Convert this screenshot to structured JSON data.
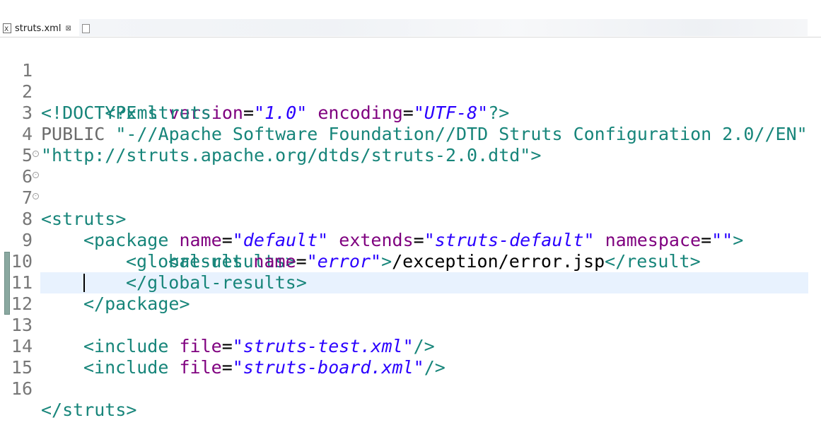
{
  "tab": {
    "label": "struts.xml",
    "close_glyph": "⊠"
  },
  "editor": {
    "lines": [
      {
        "n": "1",
        "fold": false
      },
      {
        "n": "2",
        "fold": false
      },
      {
        "n": "3",
        "fold": false
      },
      {
        "n": "4",
        "fold": false
      },
      {
        "n": "5",
        "fold": false
      },
      {
        "n": "6",
        "fold": true
      },
      {
        "n": "7",
        "fold": true
      },
      {
        "n": "8",
        "fold": true
      },
      {
        "n": "9",
        "fold": false
      },
      {
        "n": "10",
        "fold": false
      },
      {
        "n": "11",
        "fold": false
      },
      {
        "n": "12",
        "fold": false
      },
      {
        "n": "13",
        "fold": false
      },
      {
        "n": "14",
        "fold": false
      },
      {
        "n": "15",
        "fold": false
      },
      {
        "n": "16",
        "fold": false
      }
    ],
    "code": {
      "l1": {
        "open": "<?xml ",
        "a1": "version",
        "eq1": "=",
        "v1": "\"1.0\"",
        "sp": " ",
        "a2": "encoding",
        "eq2": "=",
        "v2": "\"UTF-8\"",
        "close": "?>"
      },
      "l2": {
        "text": "<!DOCTYPE struts"
      },
      "l3": {
        "kw": "PUBLIC ",
        "str": "\"-//Apache Software Foundation//DTD Struts Configuration 2.0//EN\""
      },
      "l4": {
        "str": "\"http://struts.apache.org/dtds/struts-2.0.dtd\"",
        "close": ">"
      },
      "l6": {
        "text": "<struts>"
      },
      "l7": {
        "open": "<package ",
        "a1": "name",
        "v1": "\"default\"",
        "a2": "extends",
        "v2": "\"struts-default\"",
        "a3": "namespace",
        "v3": "\"\"",
        "close": ">"
      },
      "l8": {
        "text": "<global-results>"
      },
      "l9": {
        "open": "<result ",
        "a1": "name",
        "v1": "\"error\"",
        "gt": ">",
        "content": "/exception/error.jsp",
        "close": "</result>"
      },
      "l10": {
        "text": "</global-results>"
      },
      "l11": {
        "text": "</package>"
      },
      "l13": {
        "open": "<include ",
        "a1": "file",
        "v1": "\"struts-test.xml\"",
        "close": "/>"
      },
      "l14": {
        "open": "<include ",
        "a1": "file",
        "v1": "\"struts-board.xml\"",
        "close": "/>"
      },
      "l16": {
        "text": "</struts>"
      }
    }
  }
}
